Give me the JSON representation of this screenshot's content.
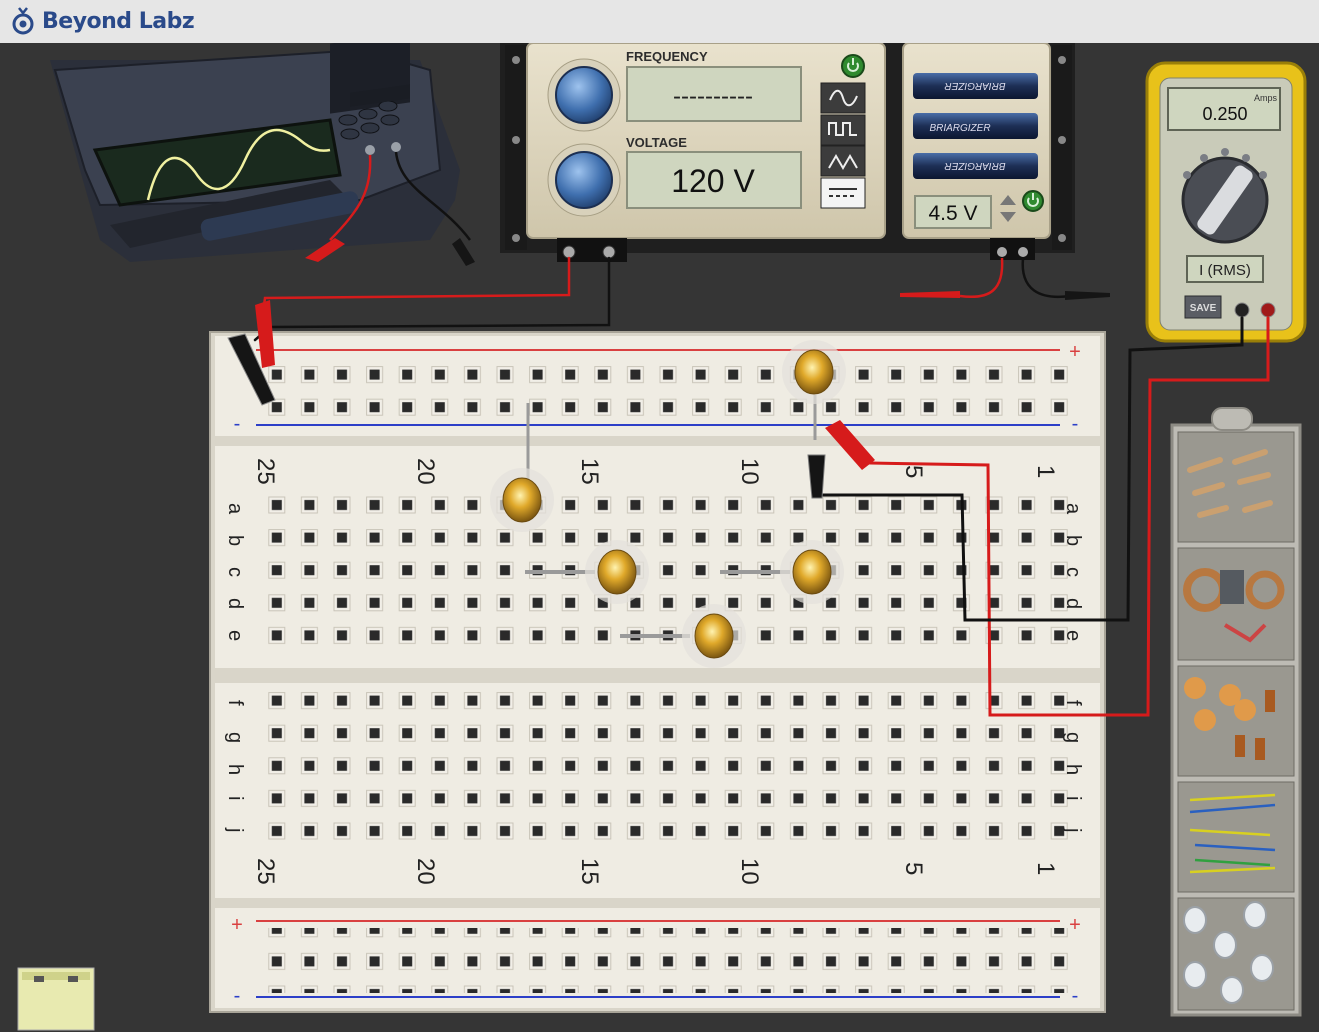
{
  "app": {
    "brand": "Beyond Labz"
  },
  "function_generator": {
    "frequency_label": "FREQUENCY",
    "frequency_value": "----------",
    "voltage_label": "VOLTAGE",
    "voltage_value": "120 V",
    "waveforms": [
      "sine-wave-icon",
      "square-wave-icon",
      "triangle-wave-icon",
      "dc-icon"
    ],
    "selected_waveform": "dc-icon"
  },
  "battery_pack": {
    "voltage": "4.5 V",
    "brand_text": [
      "BRIARGIZER",
      "BRIARGIZER",
      "BRIARGIZER"
    ]
  },
  "multimeter": {
    "unit": "Amps",
    "reading": "0.250",
    "mode": "I (RMS)",
    "save_label": "SAVE"
  },
  "breadboard": {
    "column_labels_top": [
      "25",
      "20",
      "15",
      "10",
      "5",
      "1"
    ],
    "column_labels_bottom": [
      "25",
      "20",
      "15",
      "10",
      "5",
      "1"
    ],
    "rows_upper": [
      "a",
      "b",
      "c",
      "d",
      "e"
    ],
    "rows_lower": [
      "f",
      "g",
      "h",
      "i",
      "j"
    ],
    "rail_plus": "+",
    "rail_minus": "-"
  },
  "parts_tray": {
    "bins": [
      "resistors-bin",
      "inductors-bin",
      "capacitors-bin",
      "wires-bin",
      "bulbs-bin"
    ]
  },
  "colors": {
    "wire_red": "#d61b1b",
    "wire_black": "#111111",
    "rail_red": "#d94040",
    "rail_blue": "#2c3fc8",
    "meter_yellow": "#e8c21a",
    "lcd": "#cfd6bf",
    "brand": "#2a4a8a"
  }
}
